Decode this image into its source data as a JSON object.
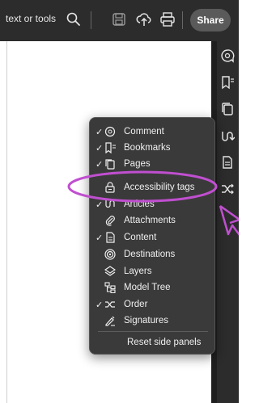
{
  "toolbar": {
    "search_text": "text or tools",
    "share_label": "Share",
    "icons": [
      "search-icon",
      "save-icon",
      "cloud-upload-icon",
      "print-icon"
    ]
  },
  "rail": {
    "icons": [
      "comment-icon",
      "bookmarks-icon",
      "pages-icon",
      "articles-icon",
      "content-icon",
      "order-icon"
    ]
  },
  "menu": {
    "items": [
      {
        "label": "Comment",
        "checked": true,
        "icon": "comment-icon"
      },
      {
        "label": "Bookmarks",
        "checked": true,
        "icon": "bookmarks-icon"
      },
      {
        "label": "Pages",
        "checked": true,
        "icon": "pages-icon"
      },
      {
        "label": "Accessibility tags",
        "checked": false,
        "icon": "accessibility-tags-icon"
      },
      {
        "label": "Articles",
        "checked": true,
        "icon": "articles-icon"
      },
      {
        "label": "Attachments",
        "checked": false,
        "icon": "attachments-icon"
      },
      {
        "label": "Content",
        "checked": true,
        "icon": "content-icon"
      },
      {
        "label": "Destinations",
        "checked": false,
        "icon": "destinations-icon"
      },
      {
        "label": "Layers",
        "checked": false,
        "icon": "layers-icon"
      },
      {
        "label": "Model Tree",
        "checked": false,
        "icon": "model-tree-icon"
      },
      {
        "label": "Order",
        "checked": true,
        "icon": "order-icon"
      },
      {
        "label": "Signatures",
        "checked": false,
        "icon": "signatures-icon"
      }
    ],
    "reset_label": "Reset side panels",
    "checkmark": "✓"
  },
  "annotation": {
    "highlight_color": "#c04fd0",
    "highlight_icon": "highlight-ellipse",
    "pointer_icon": "arrow-pointer-icon"
  }
}
